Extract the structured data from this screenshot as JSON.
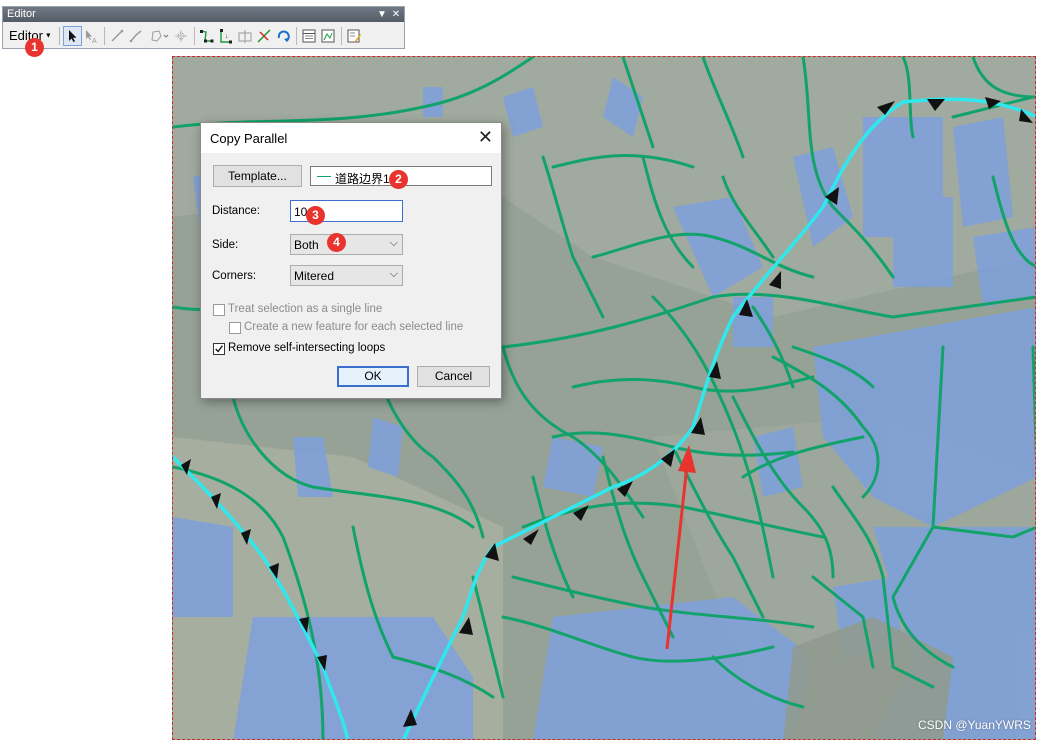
{
  "toolbar": {
    "title": "Editor",
    "menu_label": "Editor"
  },
  "dialog": {
    "title": "Copy Parallel",
    "template_button": "Template...",
    "template_value": "道路边界1",
    "distance_label": "Distance:",
    "distance_value": "10",
    "side_label": "Side:",
    "side_value": "Both",
    "corners_label": "Corners:",
    "corners_value": "Mitered",
    "treat_single_line": "Treat selection as a single line",
    "create_new_feature": "Create a new feature for each selected line",
    "remove_loops": "Remove self-intersecting loops",
    "ok": "OK",
    "cancel": "Cancel"
  },
  "options": {
    "treat_single_line_checked": false,
    "create_new_feature_checked": false,
    "remove_loops_checked": true
  },
  "badges": [
    "1",
    "2",
    "3",
    "4"
  ],
  "colors": {
    "road": "#11a36a",
    "selected_line": "#2fe8ee",
    "water": "#7ea0dd",
    "annotation_arrow": "#e8332f",
    "badge": "#e8332f"
  },
  "watermark": "CSDN @YuanYWRS"
}
